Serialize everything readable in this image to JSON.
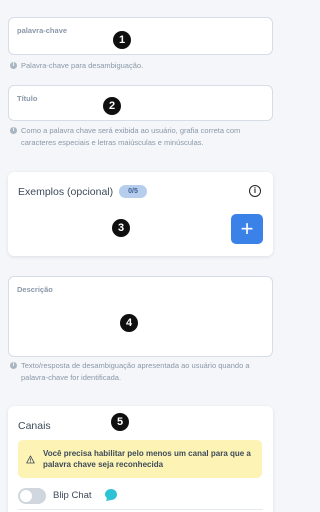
{
  "keyword_field": {
    "label": "palavra-chave",
    "value": ""
  },
  "keyword_help": "Palavra-chave para desambiguação.",
  "title_field": {
    "label": "Título",
    "value": ""
  },
  "title_help": "Como a palavra chave será exibida ao usuário, grafia correta com caracteres especiais e letras maiúsculas e minúsculas.",
  "examples": {
    "title": "Exemplos (opcional)",
    "count": "0/5",
    "info_icon": "info-icon",
    "add_icon": "plus-icon",
    "add_label": "+"
  },
  "description_field": {
    "label": "Descrição",
    "value": ""
  },
  "description_help": "Texto/resposta de desambiguação apresentada ao usuário quando a palavra-chave for identificada.",
  "channels": {
    "title": "Canais",
    "warning": "Você precisa habilitar pelo menos um canal para que a palavra chave seja reconhecida",
    "warning_icon": "warning-triangle-icon",
    "items": [
      {
        "label": "Blip Chat",
        "enabled": false,
        "icon": "blip-chat-icon"
      }
    ]
  },
  "markers": [
    "1",
    "2",
    "3",
    "4",
    "5"
  ],
  "colors": {
    "accent": "#3b82e8",
    "badge_bg": "#b6cdee",
    "warning_bg": "#fdf3b5",
    "blip": "#2cc3d5"
  }
}
